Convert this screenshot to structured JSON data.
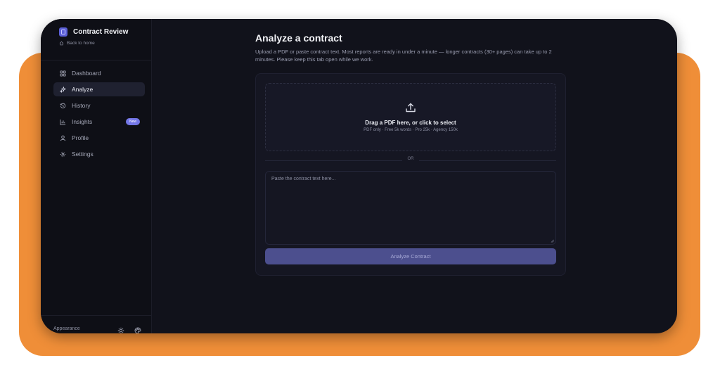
{
  "sidebar": {
    "brand": "Contract Review",
    "back_label": "Back to home",
    "items": [
      {
        "label": "Dashboard",
        "icon": "grid-icon"
      },
      {
        "label": "Analyze",
        "icon": "sparkles-icon",
        "active": true
      },
      {
        "label": "History",
        "icon": "history-icon"
      },
      {
        "label": "Insights",
        "icon": "bar-chart-icon",
        "badge": "New"
      },
      {
        "label": "Profile",
        "icon": "user-icon"
      },
      {
        "label": "Settings",
        "icon": "gear-icon"
      }
    ],
    "appearance_label": "Appearance"
  },
  "main": {
    "title": "Analyze a contract",
    "description": "Upload a PDF or paste contract text. Most reports are ready in under a minute — longer contracts (30+ pages) can take up to 2 minutes. Please keep this tab open while we work.",
    "dropzone": {
      "title": "Drag a PDF here, or click to select",
      "subtitle": "PDF only · Free 5k words · Pro 25k · Agency 150k"
    },
    "divider_label": "OR",
    "textarea_placeholder": "Paste the contract text here...",
    "submit_label": "Analyze Contract"
  },
  "colors": {
    "accent": "#5b5fd6",
    "button_disabled": "#4c4f8e",
    "backdrop": "#ef8e38",
    "app_bg": "#11121b"
  }
}
